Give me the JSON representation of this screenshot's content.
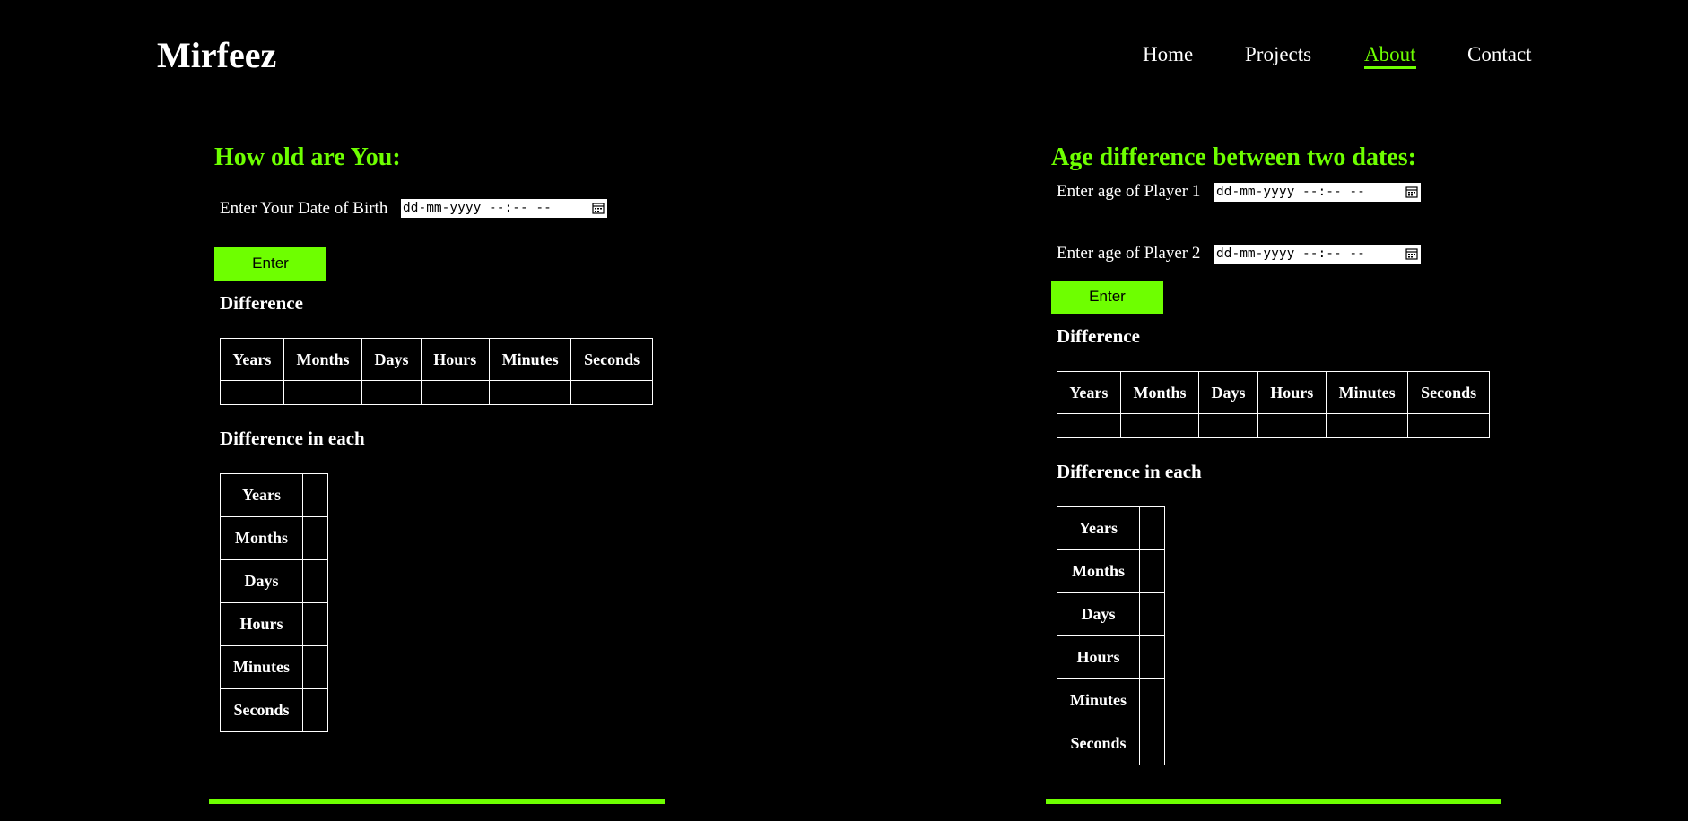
{
  "site": {
    "logo": "Mirfeez"
  },
  "nav": {
    "home": "Home",
    "projects": "Projects",
    "about": "About",
    "contact": "Contact"
  },
  "left": {
    "heading": "How old are You:",
    "dob_label": "Enter Your Date of Birth",
    "dob_placeholder": "dd-mm-yyyy --:-- --",
    "enter": "Enter",
    "difference": "Difference",
    "difference_each": "Difference in each"
  },
  "right": {
    "heading": "Age difference between two dates:",
    "player1_label": "Enter age of Player 1",
    "player2_label": "Enter age of Player 2",
    "date_placeholder": "dd-mm-yyyy --:-- --",
    "enter": "Enter",
    "difference": "Difference",
    "difference_each": "Difference in each"
  },
  "units": [
    "Years",
    "Months",
    "Days",
    "Hours",
    "Minutes",
    "Seconds"
  ],
  "colors": {
    "accent": "#6eff00",
    "background": "#000000",
    "text": "#ffffff"
  }
}
